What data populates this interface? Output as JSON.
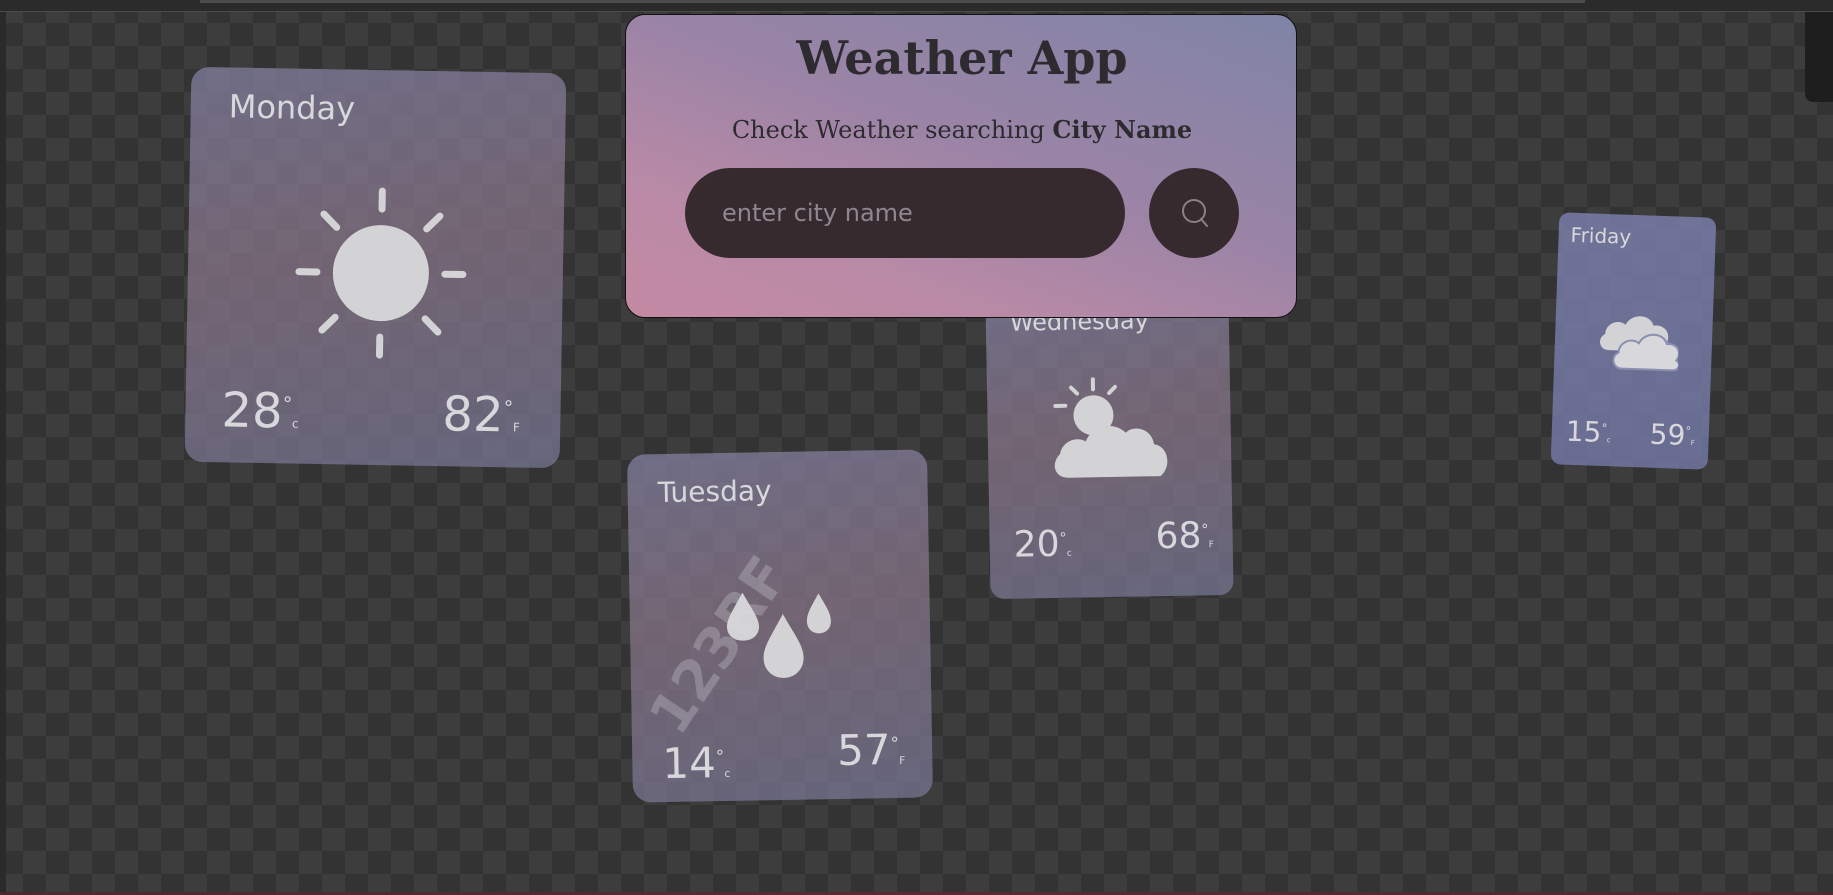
{
  "app": {
    "title": "Weather App",
    "subtitle_prefix": "Check Weather searching ",
    "subtitle_bold": "City Name",
    "search_placeholder": "enter city name",
    "search_value": "",
    "search_icon": "search-icon"
  },
  "background_cards": [
    {
      "day": "Monday",
      "celsius": "28",
      "fahrenheit": "82",
      "unit_c": "°",
      "unit_c_letter": "c",
      "unit_f": "°",
      "unit_f_letter": "F",
      "icon": "sun-icon"
    },
    {
      "day": "Tuesday",
      "celsius": "14",
      "fahrenheit": "57",
      "unit_c": "°",
      "unit_c_letter": "c",
      "unit_f": "°",
      "unit_f_letter": "F",
      "icon": "rain-drops-icon"
    },
    {
      "day": "Wednesday",
      "celsius": "20",
      "fahrenheit": "68",
      "unit_c": "°",
      "unit_c_letter": "c",
      "unit_f": "°",
      "unit_f_letter": "F",
      "icon": "partly-cloudy-icon"
    },
    {
      "day": "Friday",
      "celsius": "15",
      "fahrenheit": "59",
      "unit_c": "°",
      "unit_c_letter": "c",
      "unit_f": "°",
      "unit_f_letter": "F",
      "icon": "cloud-icon"
    }
  ],
  "watermark": "123RF",
  "colors": {
    "panel_gradient_start": "#7f84a6",
    "panel_gradient_end": "#c489a3",
    "input_bg": "#362a2f",
    "title_text": "#2e2b30"
  }
}
